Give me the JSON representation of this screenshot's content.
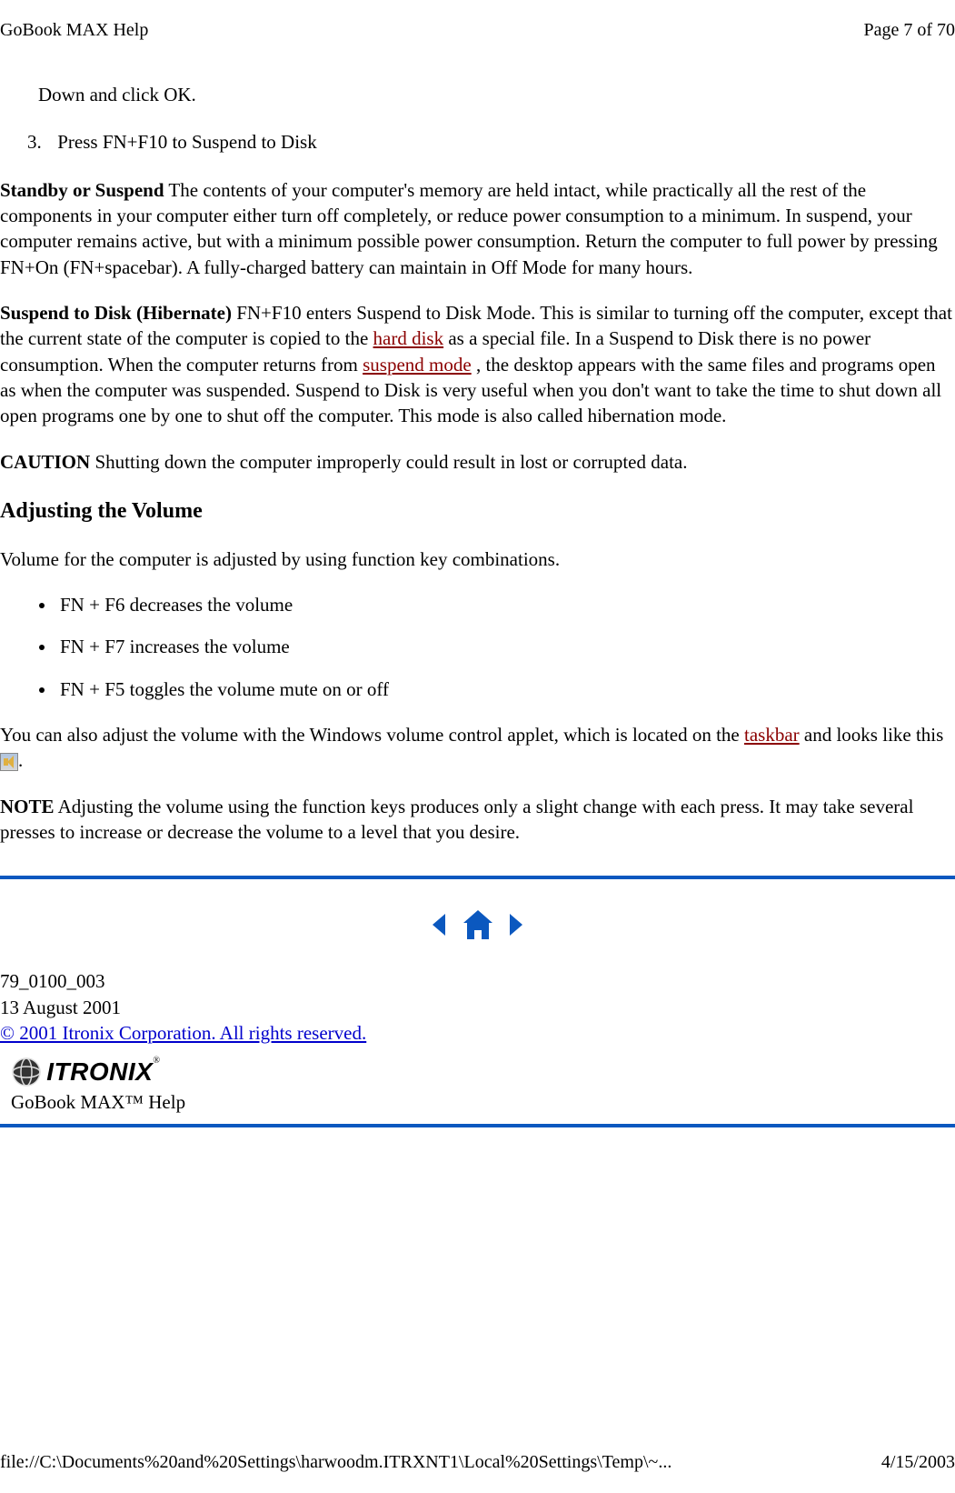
{
  "header": {
    "left": "GoBook MAX Help",
    "right": "Page 7 of 70"
  },
  "list_prev": "Down and click OK.",
  "list_num3": {
    "num": "3.",
    "text": "Press FN+F10 to Suspend to Disk"
  },
  "standby": {
    "label": "Standby or Suspend",
    "text": "   The contents of your computer's memory are held intact, while practically all the rest of the components in your computer either turn off completely, or reduce power consumption to a minimum.  In suspend, your computer remains active, but with a minimum possible power consumption.  Return the computer to full power by pressing FN+On (FN+spacebar).  A fully-charged battery can maintain in Off Mode for many hours."
  },
  "hibernate": {
    "label": "Suspend to Disk (Hibernate)",
    "t1": "  FN+F10 enters Suspend to Disk Mode.  This  is similar to turning off the computer, except that the current state of the computer is copied to the ",
    "link1": "hard disk",
    "t2": " as a special file.  In a Suspend to Disk there is no power consumption. When the computer returns from ",
    "link2": "suspend mode",
    "t3": " , the desktop appears with the same files and programs open as when the computer was suspended.  Suspend to Disk is very useful when you don't want to take the time to shut down all open programs one by one to shut off the computer.  This mode is also called hibernation mode."
  },
  "caution": {
    "label": "CAUTION",
    "text": "  Shutting down the computer improperly could result in lost or corrupted data."
  },
  "vol_heading": "Adjusting the Volume",
  "vol_intro": "Volume for the computer is adjusted by using function key combinations.",
  "bullets": [
    "FN + F6 decreases the volume",
    "FN + F7 increases the volume",
    "FN + F5  toggles the volume mute on or off"
  ],
  "vol_applet": {
    "t1": "You can also adjust the volume with the Windows volume control applet, which is located on the ",
    "link": "taskbar",
    "t2": " and looks like this ",
    "t3": "."
  },
  "note": {
    "label": "NOTE",
    "text": "  Adjusting the volume using the function keys produces only a slight change with each press.  It may take several presses to increase or decrease the volume to a level that you desire."
  },
  "footer_meta": {
    "docnum": "79_0100_003",
    "date": "13 August 2001",
    "copyright": "© 2001 Itronix Corporation.  All rights reserved."
  },
  "logo_text": "ITRONIX",
  "help_title": "GoBook MAX™ Help",
  "footer": {
    "left": "file://C:\\Documents%20and%20Settings\\harwoodm.ITRXNT1\\Local%20Settings\\Temp\\~...",
    "right": "4/15/2003"
  }
}
